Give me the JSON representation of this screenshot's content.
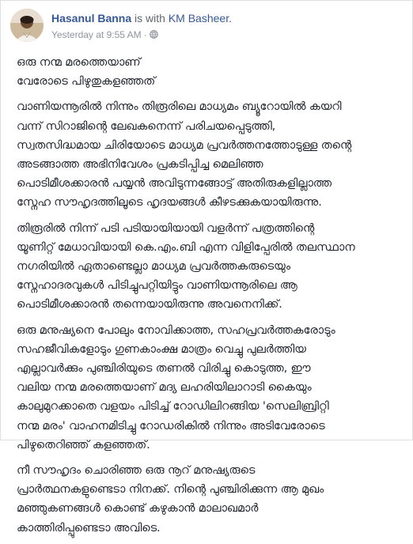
{
  "post": {
    "author": "Hasanul Banna",
    "with_text": " is with ",
    "tagged": "KM Basheer.",
    "timestamp": "Yesterday at 9:55 AM",
    "privacy_icon": "globe-icon",
    "paragraphs": [
      "ഒരു നന്മ മരത്തെയാണ്\nവേരോടെ പിഴുതുകളഞ്ഞത്",
      "വാണിയന്നൂരിൽ നിന്നും തിരൂരിലെ മാധ്യമം ബ്യൂറോയിൽ കയറി\nവന്ന് സിറാജിന്റെ ലേഖകനെന്ന് പരിചയപ്പെടുത്തി,\nസ്വതസിദ്ധമായ ചിരിയോടെ മാധ്യമ പ്രവർത്തനത്തോടുള്ള തന്റെ\nഅടങ്ങാത്ത അഭിനിവേശം പ്രകടിപ്പിച്ച മെലിഞ്ഞ\nപൊടിമീശക്കാരൻ പയ്യൻ അവിടുന്നങ്ങോട്ട് അതിരുകളില്ലാത്ത\nസ്നേഹ സൗഹൃദത്തിലൂടെ ഹൃദയങ്ങൾ കീഴടക്കുകയായിരുന്നു.",
      "തിരൂരിൽ നിന്ന് പടി പടിയായിയായി വളർന്ന് പത്രത്തിന്റെ\nയൂണിറ്റ് മേധാവിയായി കെ.എം.ബി എന്ന വിളിപ്പേരിൽ തലസ്ഥാന\nനഗരിയിൽ ഏതാണ്ടെല്ലാ മാധ്യമ പ്രവർത്തകരുടെയും\nസ്നേഹാദരവുകൾ പിടിച്ചുപറ്റിയിട്ടും വാണിയന്നൂരിലെ ആ\nപൊടിമീശക്കാരൻ തന്നെയായിരുന്നു അവനെനിക്ക്.",
      "ഒരു മനുഷ്യനെ പോലും നോവിക്കാത്ത, സഹപ്രവർത്തകരോടും\nസഹജീവികളോടും ഗുണകാംക്ഷ മാത്രം വെച്ചു പുലർത്തിയ\nഎല്ലാവർക്കും പുഞ്ചിരിയുടെ തണൽ വിരിച്ചു കൊടുത്ത, ഈ\nവലിയ നന്മ മരത്തെയാണ് മദ്യ ലഹരിയിലാറാടി കൈയും\nകാലുമുറക്കാതെ വളയം പിടിച്ച് റോഡിലിറങ്ങിയ 'സെലിബ്രിറ്റി\nനന്മ മരം' വാഹനമിടിച്ചു റോഡരികിൽ നിന്നും അടിവേരോടെ\nപിഴുതെറിഞ്ഞ് കളഞ്ഞത്.",
      "നീ സൗഹൃദം ചൊരിഞ്ഞ ഒരു നൂറ് മനുഷ്യരുടെ\nപ്രാർത്ഥനകളുണ്ടെടാ നിനക്ക്. നിന്റെ പുഞ്ചിരിക്കുന്ന ആ മുഖം\nമഞ്ഞുകണങ്ങൾ കൊണ്ട് കഴുകാൻ മാലാഖമാർ\nകാത്തിരിപ്പുണ്ടെടാ അവിടെ."
    ]
  },
  "colors": {
    "link": "#365899",
    "meta": "#90949c",
    "text": "#1d2129"
  }
}
